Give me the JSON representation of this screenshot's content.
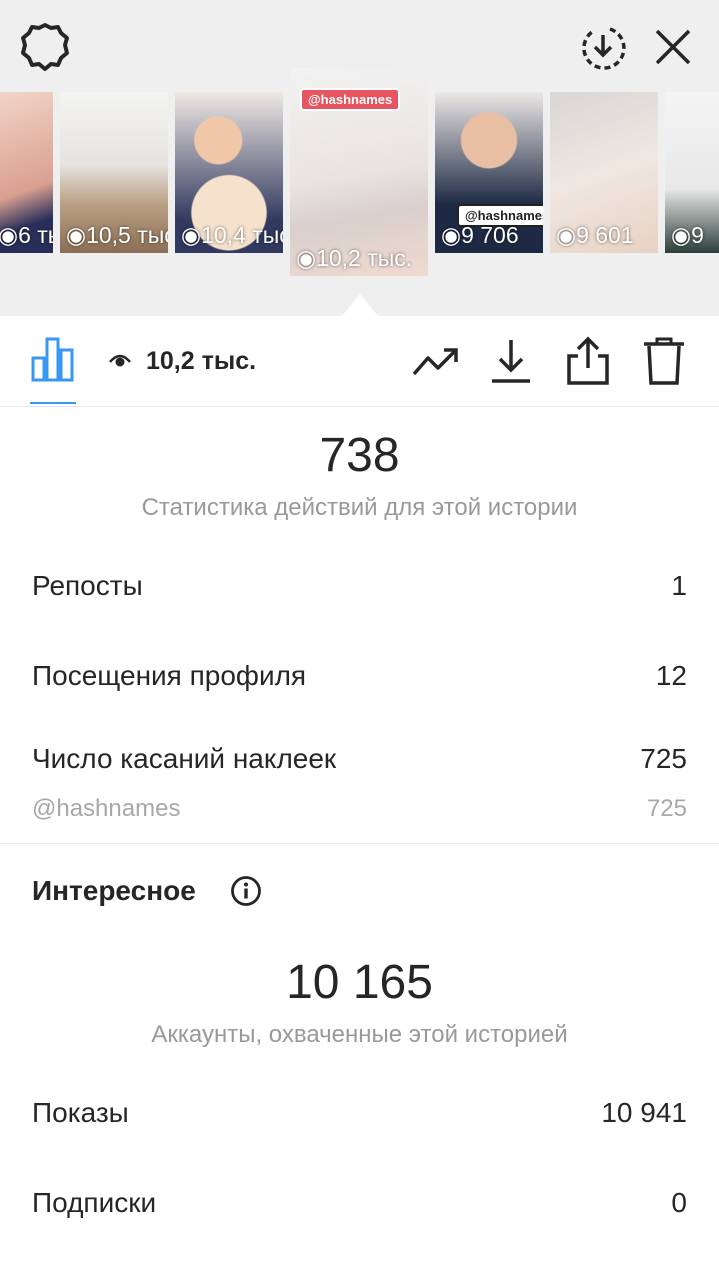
{
  "header": {
    "settings_icon": "settings-gear-icon",
    "download_icon": "download-circle-icon",
    "close_icon": "close-icon"
  },
  "thumbnails": [
    {
      "views": "6 тыс."
    },
    {
      "views": "10,5 тыс."
    },
    {
      "views": "10,4 тыс."
    },
    {
      "views": "10,2 тыс.",
      "active": true,
      "sticker": "@hashnames"
    },
    {
      "views": "9 706",
      "sticker": "@hashnames"
    },
    {
      "views": "9 601"
    },
    {
      "views": "9"
    }
  ],
  "toolbar": {
    "views_value": "10,2 тыс.",
    "icons": [
      "bar-chart-icon",
      "eye-icon",
      "trend-icon",
      "download-icon",
      "share-icon",
      "trash-icon"
    ]
  },
  "actions": {
    "total": "738",
    "caption": "Статистика действий для этой истории",
    "rows": [
      {
        "label": "Репосты",
        "value": "1"
      },
      {
        "label": "Посещения профиля",
        "value": "12"
      },
      {
        "label": "Число касаний наклеек",
        "value": "725"
      }
    ],
    "sticker_row": {
      "label": "@hashnames",
      "value": "725"
    }
  },
  "discovery": {
    "title": "Интересное",
    "total": "10 165",
    "caption": "Аккаунты, охваченные этой историей",
    "rows": [
      {
        "label": "Показы",
        "value": "10 941"
      },
      {
        "label": "Подписки",
        "value": "0"
      }
    ]
  },
  "colors": {
    "accent": "#3897f0",
    "sticker": "#e8545f"
  }
}
